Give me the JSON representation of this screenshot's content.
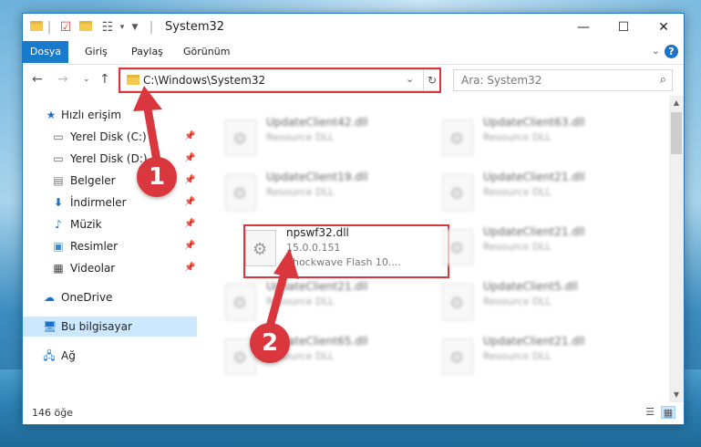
{
  "window": {
    "title": "System32",
    "controls": {
      "minimize": "—",
      "maximize": "☐",
      "close": "✕"
    }
  },
  "ribbon": {
    "tabs": [
      "Dosya",
      "Giriş",
      "Paylaş",
      "Görünüm"
    ]
  },
  "address": {
    "path": "C:\\Windows\\System32"
  },
  "search": {
    "placeholder": "Ara: System32"
  },
  "sidebar": {
    "items": [
      {
        "label": "Hızlı erişim",
        "icon": "star-icon"
      },
      {
        "label": "Yerel Disk (C:)",
        "icon": "drive-icon"
      },
      {
        "label": "Yerel Disk (D:)",
        "icon": "drive-icon"
      },
      {
        "label": "Belgeler",
        "icon": "documents-icon"
      },
      {
        "label": "İndirmeler",
        "icon": "download-icon"
      },
      {
        "label": "Müzik",
        "icon": "music-icon"
      },
      {
        "label": "Resimler",
        "icon": "pictures-icon"
      },
      {
        "label": "Videolar",
        "icon": "videos-icon"
      },
      {
        "label": "OneDrive",
        "icon": "cloud-icon"
      },
      {
        "label": "Bu bilgisayar",
        "icon": "computer-icon"
      },
      {
        "label": "Ağ",
        "icon": "network-icon"
      }
    ]
  },
  "files": [
    {
      "name": "UpdateClient42.dll",
      "line1": "Resource DLL",
      "line2": ""
    },
    {
      "name": "UpdateClient63.dll",
      "line1": "Resource DLL",
      "line2": ""
    },
    {
      "name": "UpdateClient19.dll",
      "line1": "Resource DLL",
      "line2": ""
    },
    {
      "name": "UpdateClient21.dll",
      "line1": "Resource DLL",
      "line2": ""
    },
    {
      "name": "npswf32.dll",
      "line1": "15.0.0.151",
      "line2": "Shockwave Flash 10...."
    },
    {
      "name": "UpdateClient21.dll",
      "line1": "Resource DLL",
      "line2": ""
    },
    {
      "name": "UpdateClient21.dll",
      "line1": "Resource DLL",
      "line2": ""
    },
    {
      "name": "UpdateClient5.dll",
      "line1": "Resource DLL",
      "line2": ""
    },
    {
      "name": "UpdateClient65.dll",
      "line1": "Resource DLL",
      "line2": ""
    },
    {
      "name": "UpdateClient21.dll",
      "line1": "Resource DLL",
      "line2": ""
    }
  ],
  "status": {
    "count": "146 öğe"
  },
  "annotations": {
    "badge1": "1",
    "badge2": "2",
    "color": "#d9363e"
  }
}
